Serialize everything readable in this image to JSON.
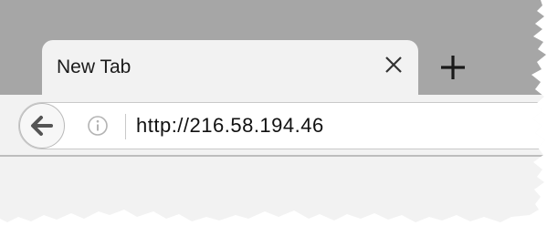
{
  "tab": {
    "title": "New Tab",
    "close_icon": "close-icon",
    "new_tab_icon": "plus-icon"
  },
  "navbar": {
    "back_icon": "back-arrow-icon",
    "info_icon": "info-icon",
    "url": "http://216.58.194.46"
  },
  "colors": {
    "tabstrip": "#a6a6a6",
    "chrome": "#f2f2f2",
    "address_bar": "#ffffff"
  }
}
